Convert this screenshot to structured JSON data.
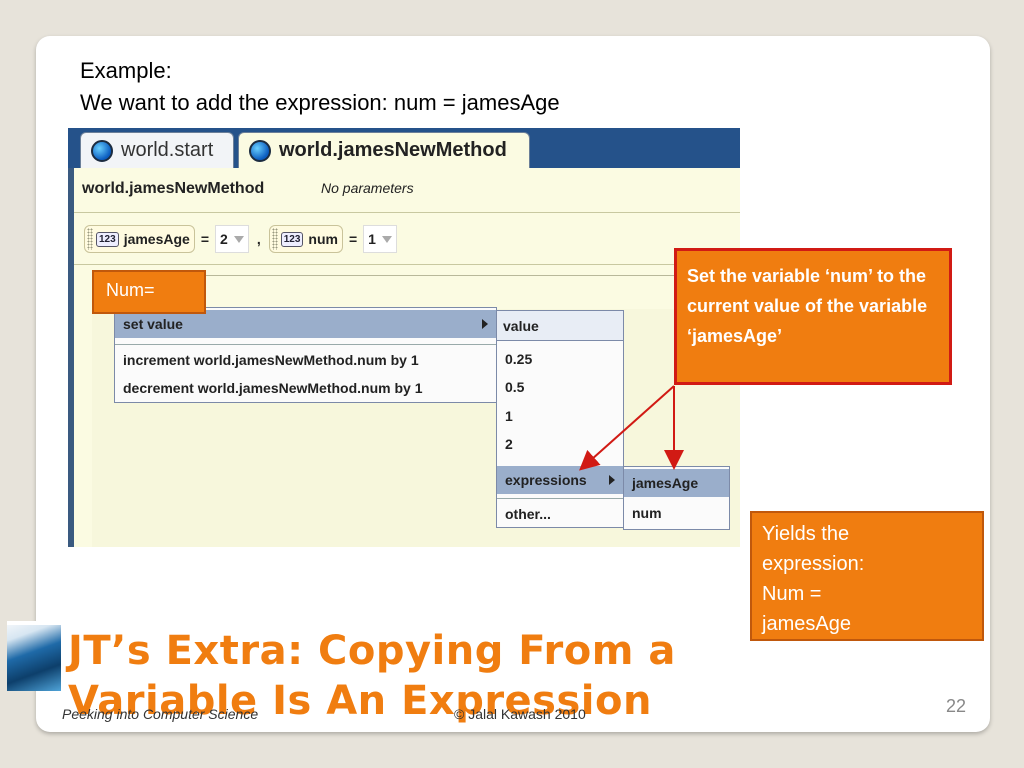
{
  "header": {
    "line1": "Example:",
    "line2": "We want to add the expression: num = jamesAge"
  },
  "alice": {
    "tabs": [
      {
        "label": "world.start"
      },
      {
        "label": "world.jamesNewMethod"
      }
    ],
    "method": {
      "name": "world.jamesNewMethod",
      "params": "No parameters"
    },
    "variables": [
      {
        "type_badge": "123",
        "name": "jamesAge",
        "eq": "=",
        "value": "2"
      },
      {
        "type_badge": "123",
        "name": "num",
        "eq": "=",
        "value": "1"
      }
    ],
    "comma": ",",
    "menu_main": [
      {
        "label": "set value"
      },
      {
        "label": "increment world.jamesNewMethod.num by 1"
      },
      {
        "label": "decrement world.jamesNewMethod.num by 1"
      }
    ],
    "menu_value": {
      "header": "value",
      "items": [
        "0.25",
        "0.5",
        "1",
        "2"
      ],
      "expressions": "expressions",
      "other": "other..."
    },
    "menu_expressions": [
      "jamesAge",
      "num"
    ]
  },
  "annotations": {
    "num_label": "Num=",
    "callout_red": "Set the variable ‘num’ to the current value of the variable ‘jamesAge’",
    "callout_yields": [
      "Yields the",
      "expression:",
      "Num =",
      "jamesAge"
    ]
  },
  "slide": {
    "title_line1": "JT’s Extra: Copying From a",
    "title_line2": "Variable Is An Expression",
    "footer_left": "Peeking into Computer Science",
    "footer_center": "© Jalal Kawash 2010",
    "page_number": "22"
  },
  "colors": {
    "accent_orange": "#f07d10",
    "callout_border_red": "#d11a14",
    "alice_blue": "#25528a",
    "menu_highlight": "#9aaecb"
  }
}
